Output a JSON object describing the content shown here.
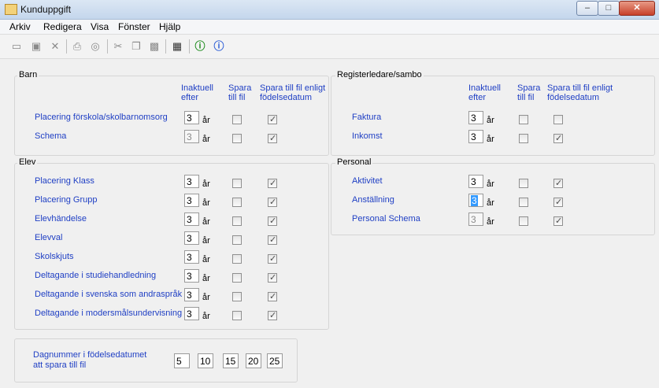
{
  "window": {
    "title": "Kunduppgift",
    "min": "–",
    "max": "□",
    "close": "✕"
  },
  "menu": [
    "Arkiv",
    "Redigera",
    "Visa",
    "Fönster",
    "Hjälp"
  ],
  "toolbar_icons": [
    "new-icon",
    "save-icon",
    "delete-icon",
    "print-icon",
    "find-icon",
    "cut-icon",
    "copy-icon",
    "paste-icon",
    "properties-icon",
    "info-icon",
    "help-icon"
  ],
  "headers": {
    "inactive": [
      "Inaktuell",
      "efter"
    ],
    "save": [
      "Spara",
      "till fil"
    ],
    "save_birth": [
      "Spara till fil enligt",
      "födelsedatum"
    ]
  },
  "unit": "år",
  "groups": {
    "barn": {
      "title": "Barn",
      "rows": [
        {
          "label": "Placering förskola/skolbarnomsorg",
          "value": "3",
          "disabled": false,
          "save": false,
          "save_birth": true
        },
        {
          "label": "Schema",
          "value": "3",
          "disabled": true,
          "save": false,
          "save_birth": true
        }
      ]
    },
    "elev": {
      "title": "Elev",
      "rows": [
        {
          "label": "Placering Klass",
          "value": "3",
          "save": false,
          "save_birth": true
        },
        {
          "label": "Placering Grupp",
          "value": "3",
          "save": false,
          "save_birth": true
        },
        {
          "label": "Elevhändelse",
          "value": "3",
          "save": false,
          "save_birth": true
        },
        {
          "label": "Elevval",
          "value": "3",
          "save": false,
          "save_birth": true
        },
        {
          "label": "Skolskjuts",
          "value": "3",
          "save": false,
          "save_birth": true
        },
        {
          "label": "Deltagande i studiehandledning",
          "value": "3",
          "save": false,
          "save_birth": true
        },
        {
          "label": "Deltagande i svenska som andraspråk",
          "value": "3",
          "save": false,
          "save_birth": true
        },
        {
          "label": "Deltagande i modersmålsundervisning",
          "value": "3",
          "save": false,
          "save_birth": true
        }
      ]
    },
    "registerledare": {
      "title": "Registerledare/sambo",
      "rows": [
        {
          "label": "Faktura",
          "value": "3",
          "save": false,
          "save_birth": false
        },
        {
          "label": "Inkomst",
          "value": "3",
          "save": false,
          "save_birth": true
        }
      ]
    },
    "personal": {
      "title": "Personal",
      "rows": [
        {
          "label": "Aktivitet",
          "value": "3",
          "save": false,
          "save_birth": true
        },
        {
          "label": "Anställning",
          "value": "3",
          "selected": true,
          "save": false,
          "save_birth": true
        },
        {
          "label": "Personal Schema",
          "value": "3",
          "disabled": true,
          "save": false,
          "save_birth": true
        }
      ]
    }
  },
  "dagnummer": {
    "label": [
      "Dagnummer i födelsedatumet",
      "att spara till fil"
    ],
    "values": [
      "5",
      "10",
      "15",
      "20",
      "25"
    ]
  }
}
